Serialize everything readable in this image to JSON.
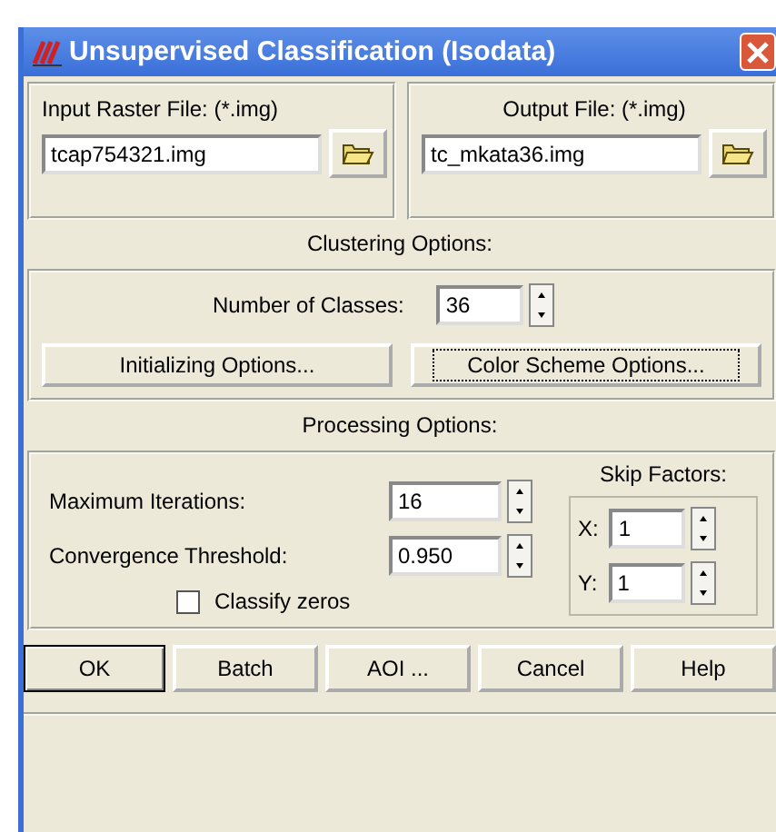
{
  "window": {
    "title": "Unsupervised Classification (Isodata)"
  },
  "input_file": {
    "label": "Input Raster File: (*.img)",
    "value": "tcap754321.img"
  },
  "output_file": {
    "label": "Output File: (*.img)",
    "value": "tc_mkata36.img"
  },
  "clustering": {
    "heading": "Clustering Options:",
    "classes_label": "Number of Classes:",
    "classes_value": "36",
    "buttons": [
      {
        "label": "Initializing Options...",
        "focused": false
      },
      {
        "label": "Color Scheme Options...",
        "focused": true
      }
    ]
  },
  "processing": {
    "heading": "Processing Options:",
    "fields": [
      {
        "label": "Maximum Iterations:",
        "value": "16"
      },
      {
        "label": "Convergence Threshold:",
        "value": "0.950"
      }
    ],
    "classify_zeros": {
      "label": "Classify zeros",
      "checked": false
    },
    "skip_factors": {
      "label": "Skip Factors:",
      "fields": [
        {
          "label": "X:",
          "value": "1"
        },
        {
          "label": "Y:",
          "value": "1"
        }
      ]
    }
  },
  "buttons": [
    {
      "label": "OK",
      "default": true
    },
    {
      "label": "Batch",
      "default": false
    },
    {
      "label": "AOI ...",
      "default": false
    },
    {
      "label": "Cancel",
      "default": false
    },
    {
      "label": "Help",
      "default": false
    }
  ]
}
